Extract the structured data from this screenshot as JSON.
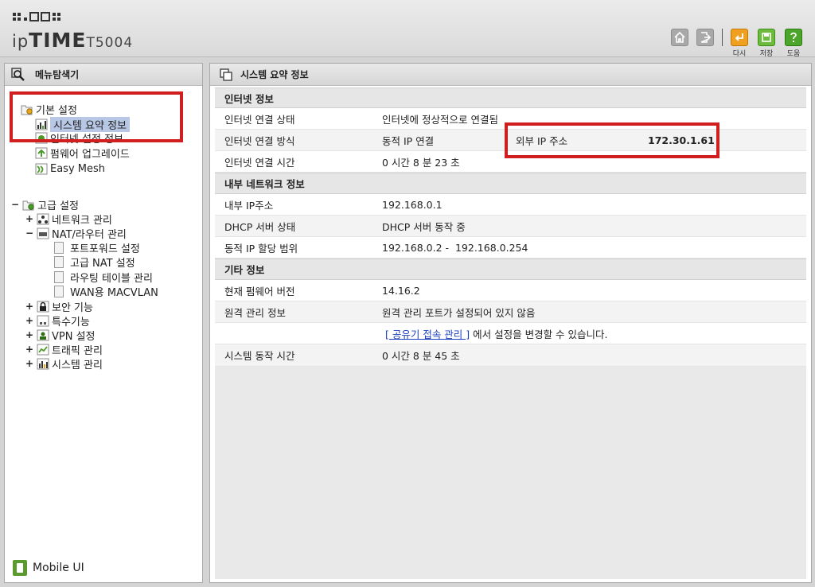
{
  "header": {
    "logo_ip": "ip",
    "logo_time": "TIME",
    "logo_model": "T5004",
    "toolbar": [
      {
        "name": "home",
        "icon": "home-icon"
      },
      {
        "name": "logout",
        "icon": "logout-icon"
      },
      {
        "name": "reload",
        "icon": "reload-icon",
        "label": "다시"
      },
      {
        "name": "save",
        "icon": "save-icon",
        "label": "저장"
      },
      {
        "name": "help",
        "icon": "help-icon",
        "label": "도움"
      }
    ]
  },
  "sidebar": {
    "title": "메뉴탐색기",
    "basic": {
      "label": "기본 설정",
      "items": [
        "시스템 요약 정보",
        "인터넷 설정 정보",
        "펌웨어 업그레이드",
        "Easy Mesh"
      ]
    },
    "advanced": {
      "label": "고급 설정",
      "items": [
        {
          "label": "네트워크 관리",
          "toggle": "+"
        },
        {
          "label": "NAT/라우터 관리",
          "toggle": "−"
        },
        {
          "label": "포트포워드 설정"
        },
        {
          "label": "고급 NAT 설정"
        },
        {
          "label": "라우팅 테이블 관리"
        },
        {
          "label": "WAN용 MACVLAN"
        },
        {
          "label": "보안 기능",
          "toggle": "+"
        },
        {
          "label": "특수기능",
          "toggle": "+"
        },
        {
          "label": "VPN 설정",
          "toggle": "+"
        },
        {
          "label": "트래픽 관리",
          "toggle": "+"
        },
        {
          "label": "시스템 관리",
          "toggle": "+"
        }
      ]
    },
    "mobile_ui": "Mobile UI"
  },
  "main": {
    "title": "시스템 요약 정보",
    "sections": [
      {
        "title": "인터넷 정보",
        "rows": [
          {
            "label": "인터넷 연결 상태",
            "value": "인터넷에 정상적으로 연결됨"
          },
          {
            "label": "인터넷 연결 방식",
            "value": "동적 IP 연결",
            "extra_label": "외부 IP 주소",
            "extra_value": "172.30.1.61"
          },
          {
            "label": "인터넷 연결 시간",
            "value": "0 시간 8 분 23 초"
          }
        ]
      },
      {
        "title": "내부 네트워크 정보",
        "rows": [
          {
            "label": "내부 IP주소",
            "value": "192.168.0.1"
          },
          {
            "label": "DHCP 서버 상태",
            "value": "DHCP 서버 동작 중"
          },
          {
            "label": "동적 IP 할당 범위",
            "value": "192.168.0.2 -  192.168.0.254"
          }
        ]
      },
      {
        "title": "기타 정보",
        "rows": [
          {
            "label": "현재 펌웨어 버전",
            "value": "14.16.2"
          },
          {
            "label": "원격 관리 정보",
            "value": "원격 관리 포트가 설정되어 있지 않음"
          },
          {
            "label": "",
            "link": "[ 공유기 접속 관리 ]",
            "value_suffix": " 에서 설정을 변경할 수 있습니다."
          },
          {
            "label": "시스템 동작 시간",
            "value": "0 시간 8 분 45 초"
          }
        ]
      }
    ]
  },
  "colors": {
    "annotation_red": "#d11f1f",
    "selected_bg": "#b8c7e6",
    "link_blue": "#1a3fbf"
  }
}
